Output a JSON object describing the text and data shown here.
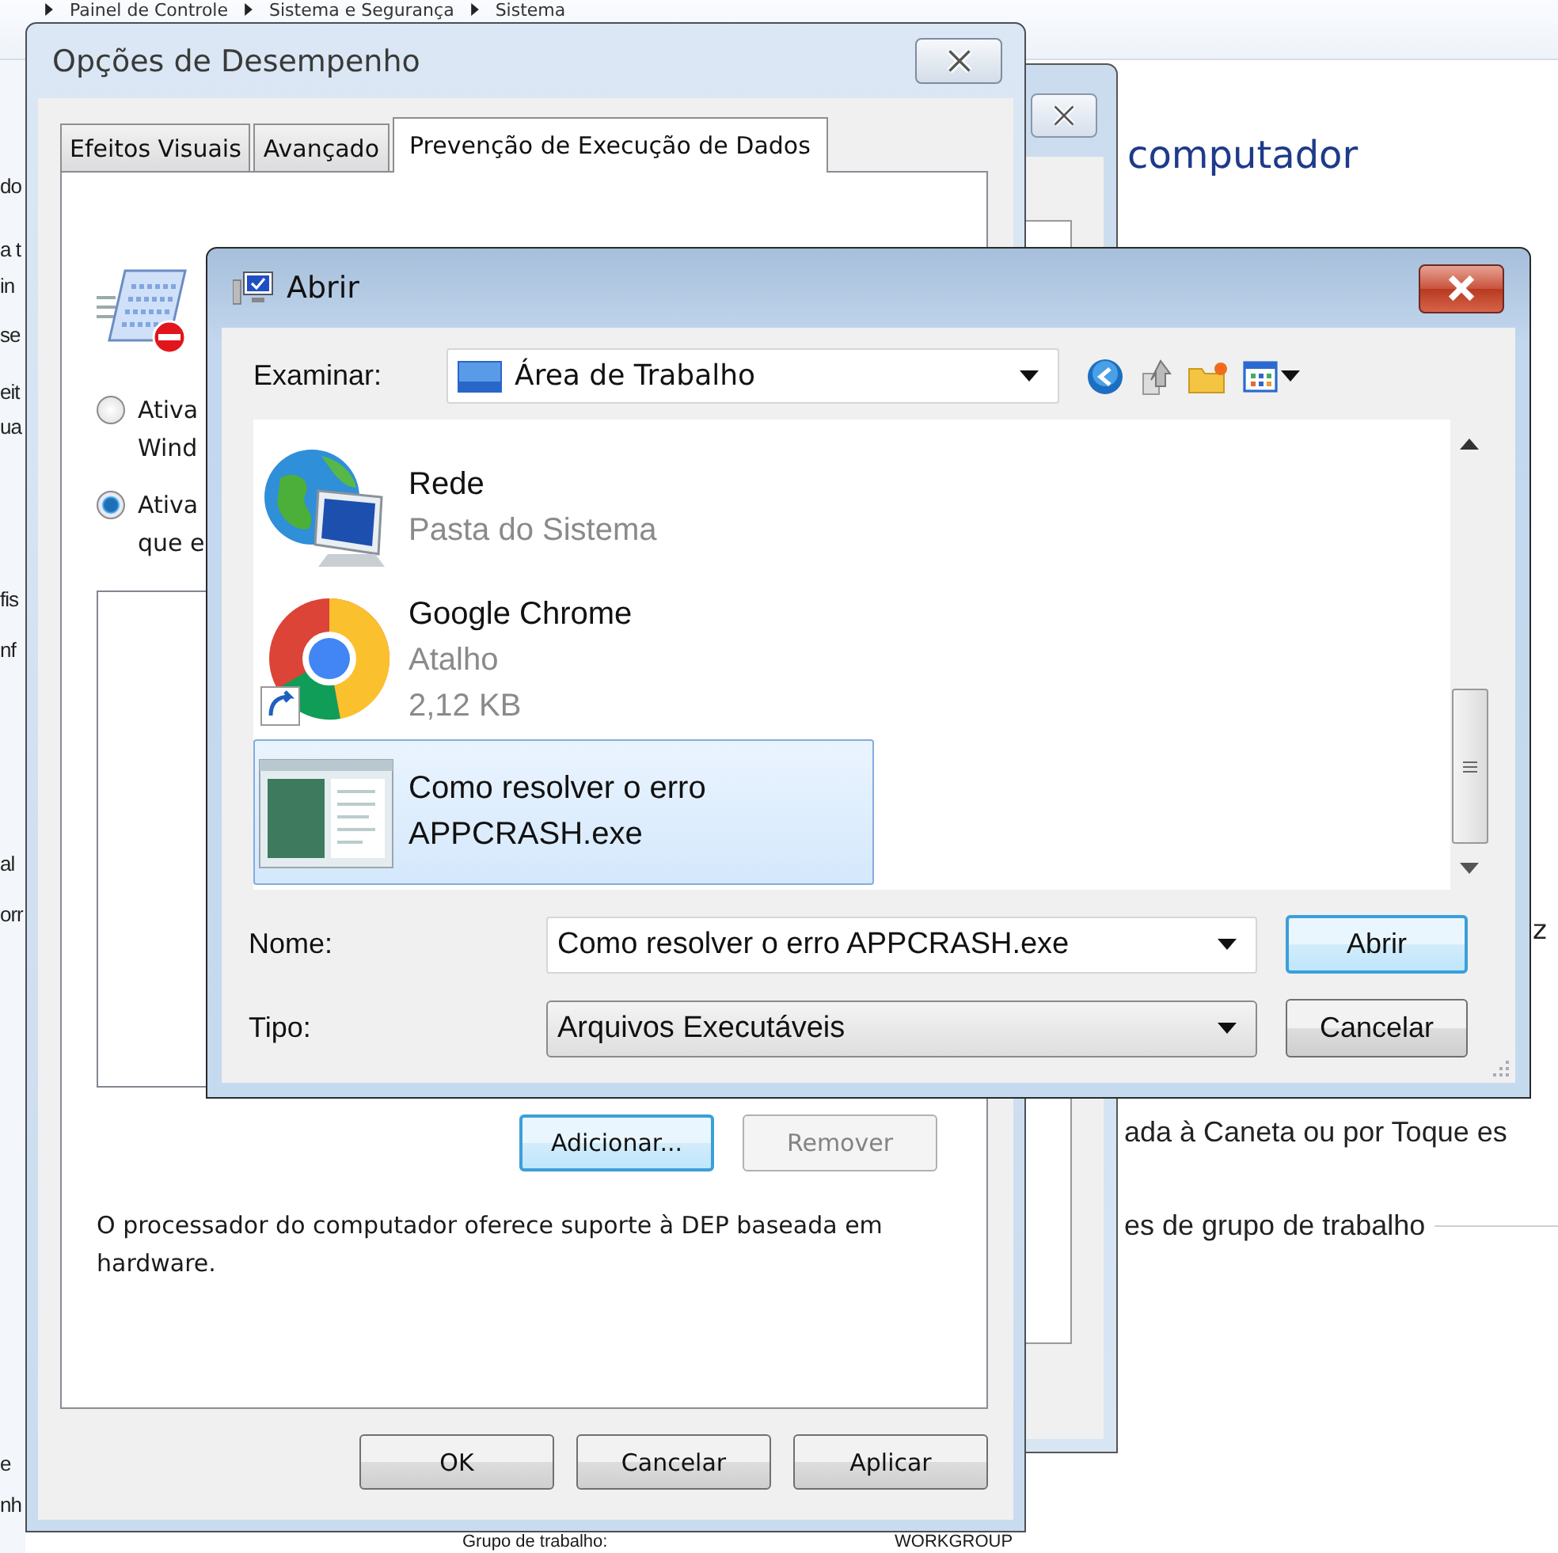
{
  "background_window": {
    "breadcrumb": [
      "Painel de Controle",
      "Sistema e Segurança",
      "Sistema"
    ],
    "heading": "computador",
    "left_fragments": [
      "do",
      "a t",
      "in",
      "se",
      "eit",
      "ua",
      "fis",
      "nf",
      "al",
      "orr",
      "e",
      "nh"
    ],
    "right_texts": [
      "z",
      "ada à Caneta ou por Toque es",
      "es de grupo de trabalho"
    ],
    "workgroup": {
      "label": "Grupo de trabalho:",
      "value": "WORKGROUP"
    }
  },
  "performance_dialog": {
    "title": "Opções de Desempenho",
    "tabs": [
      {
        "label": "Efeitos Visuais",
        "selected": false
      },
      {
        "label": "Avançado",
        "selected": false
      },
      {
        "label": "Prevenção de Execução de Dados",
        "selected": true
      }
    ],
    "radios": [
      {
        "lines": [
          "Ativa",
          "Wind"
        ],
        "selected": false
      },
      {
        "lines": [
          "Ativa",
          "que e"
        ],
        "selected": true
      }
    ],
    "list_buttons": [
      {
        "label": "Adicionar...",
        "focused": true,
        "disabled": false
      },
      {
        "label": "Remover",
        "focused": false,
        "disabled": true
      }
    ],
    "note": "O processador do computador oferece suporte à DEP baseada em hardware.",
    "buttons": [
      "OK",
      "Cancelar",
      "Aplicar"
    ]
  },
  "open_dialog": {
    "title": "Abrir",
    "look_in": {
      "label": "Examinar:",
      "value": "Área de Trabalho"
    },
    "files": [
      {
        "kind": "network",
        "name": "Rede",
        "details": [
          "Pasta do Sistema"
        ],
        "selected": false
      },
      {
        "kind": "shortcut",
        "name": "Google Chrome",
        "details": [
          "Atalho",
          "2,12 KB"
        ],
        "selected": false
      },
      {
        "kind": "document",
        "name": "Como resolver o erro APPCRASH.exe",
        "selected": true
      }
    ],
    "name_field": {
      "label": "Nome:",
      "value": "Como resolver o erro APPCRASH.exe"
    },
    "type_field": {
      "label": "Tipo:",
      "value": "Arquivos Executáveis"
    },
    "buttons": [
      {
        "label": "Abrir",
        "focused": true
      },
      {
        "label": "Cancelar",
        "focused": false
      }
    ]
  }
}
